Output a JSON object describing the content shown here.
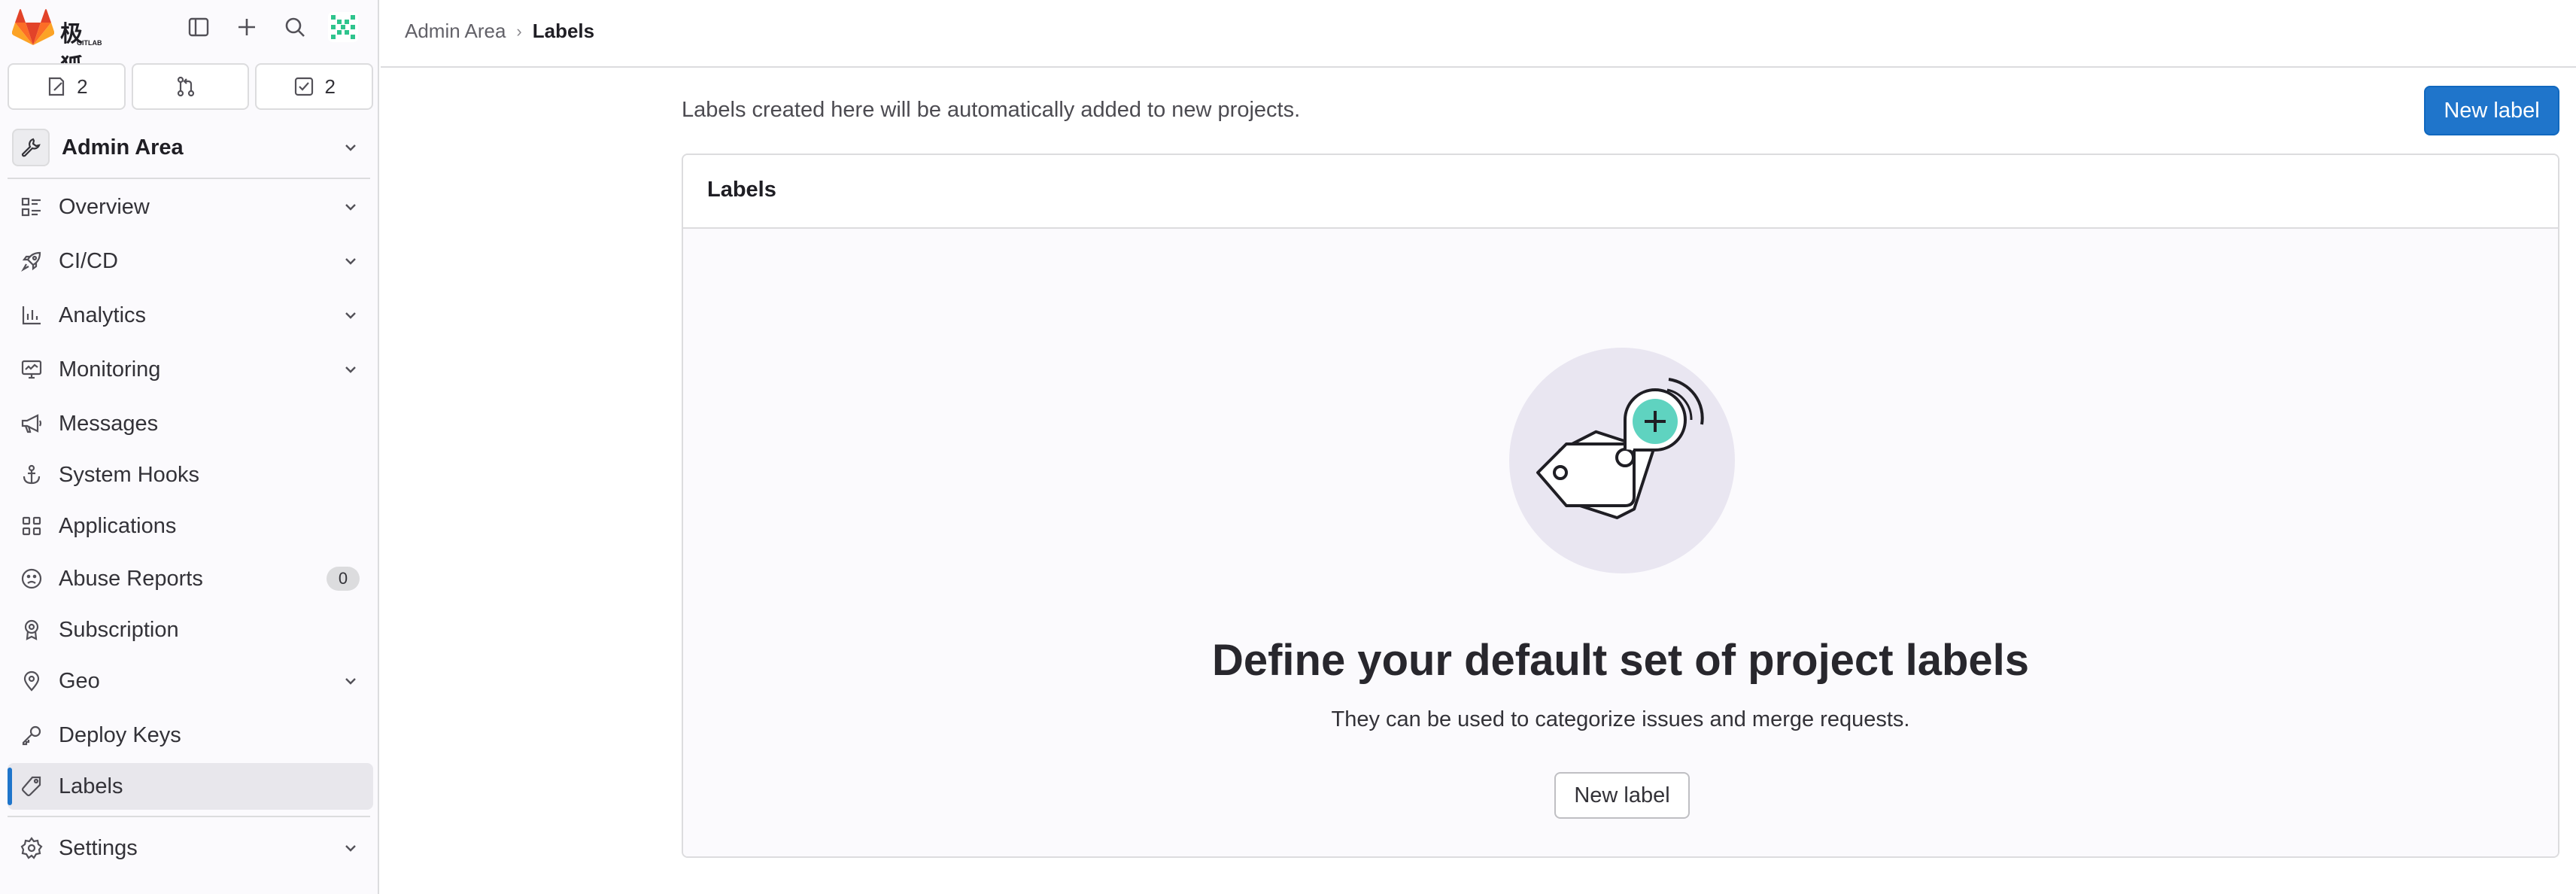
{
  "app": {
    "logo_text": "极狐",
    "logo_subtext": "GITLAB"
  },
  "counters": {
    "issues": "2",
    "merge_requests": "",
    "todos": "2"
  },
  "context": {
    "label": "Admin Area"
  },
  "sidebar": {
    "items": [
      {
        "label": "Overview",
        "icon": "overview-icon",
        "has_chevron": true
      },
      {
        "label": "CI/CD",
        "icon": "rocket-icon",
        "has_chevron": true
      },
      {
        "label": "Analytics",
        "icon": "chart-icon",
        "has_chevron": true
      },
      {
        "label": "Monitoring",
        "icon": "monitor-icon",
        "has_chevron": true
      },
      {
        "label": "Messages",
        "icon": "bullhorn-icon",
        "has_chevron": false
      },
      {
        "label": "System Hooks",
        "icon": "anchor-icon",
        "has_chevron": false
      },
      {
        "label": "Applications",
        "icon": "applications-icon",
        "has_chevron": false
      },
      {
        "label": "Abuse Reports",
        "icon": "sad-face-icon",
        "has_chevron": false,
        "badge": "0"
      },
      {
        "label": "Subscription",
        "icon": "license-icon",
        "has_chevron": false
      },
      {
        "label": "Geo",
        "icon": "location-icon",
        "has_chevron": true
      },
      {
        "label": "Deploy Keys",
        "icon": "key-icon",
        "has_chevron": false
      },
      {
        "label": "Labels",
        "icon": "label-icon",
        "has_chevron": false,
        "active": true
      },
      {
        "label": "Settings",
        "icon": "settings-icon",
        "has_chevron": true
      }
    ]
  },
  "breadcrumb": {
    "parent": "Admin Area",
    "current": "Labels"
  },
  "main": {
    "intro": "Labels created here will be automatically added to new projects.",
    "new_label_button": "New label",
    "card_title": "Labels",
    "empty_title": "Define your default set of project labels",
    "empty_description": "They can be used to categorize issues and merge requests.",
    "empty_button": "New label"
  },
  "colors": {
    "primary": "#1f75cb",
    "sidebar_bg": "#fbfafd",
    "illustration_circle": "#e9e6f1",
    "illustration_accent": "#5fd3c0"
  }
}
